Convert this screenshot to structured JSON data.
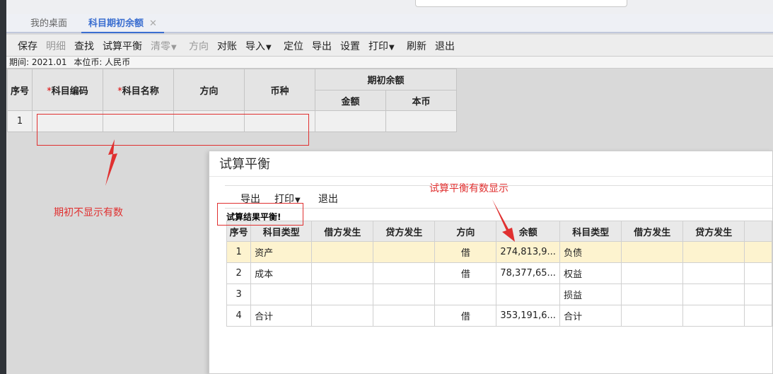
{
  "tabs": {
    "home": "我的桌面",
    "active": "科目期初余额",
    "close": "✕"
  },
  "toolbar": {
    "save": "保存",
    "detail": "明细",
    "find": "查找",
    "trial": "试算平衡",
    "clear": "清零",
    "direction": "方向",
    "reconcile": "对账",
    "import": "导入",
    "locate": "定位",
    "export": "导出",
    "settings": "设置",
    "print": "打印",
    "refresh": "刷新",
    "exit": "退出"
  },
  "period": {
    "label": "期间: 2021.01",
    "currency": "本位币: 人民币"
  },
  "grid": {
    "headers": {
      "seq": "序号",
      "code": "科目编码",
      "name": "科目名称",
      "dir": "方向",
      "cur": "币种",
      "opening": "期初余额",
      "amount": "金额",
      "base": "本币"
    },
    "required_mark": "*",
    "rows": [
      {
        "seq": "1"
      }
    ]
  },
  "annotations": {
    "left": "期初不显示有数",
    "right": "试算平衡有数显示"
  },
  "dialog": {
    "title": "试算平衡",
    "toolbar": {
      "export": "导出",
      "print": "打印",
      "exit": "退出"
    },
    "status": "试算结果平衡!",
    "headers": {
      "seq": "序号",
      "type1": "科目类型",
      "debit1": "借方发生",
      "credit1": "贷方发生",
      "dir": "方向",
      "balance": "余额",
      "type2": "科目类型",
      "debit2": "借方发生",
      "credit2": "贷方发生"
    },
    "rows": [
      {
        "seq": "1",
        "type1": "资产",
        "debit1": "",
        "credit1": "",
        "dir": "借",
        "balance": "274,813,9...",
        "type2": "负债",
        "debit2": "",
        "credit2": ""
      },
      {
        "seq": "2",
        "type1": "成本",
        "debit1": "",
        "credit1": "",
        "dir": "借",
        "balance": "78,377,65...",
        "type2": "权益",
        "debit2": "",
        "credit2": ""
      },
      {
        "seq": "3",
        "type1": "",
        "debit1": "",
        "credit1": "",
        "dir": "",
        "balance": "",
        "type2": "损益",
        "debit2": "",
        "credit2": ""
      },
      {
        "seq": "4",
        "type1": "合计",
        "debit1": "",
        "credit1": "",
        "dir": "借",
        "balance": "353,191,6...",
        "type2": "合计",
        "debit2": "",
        "credit2": ""
      }
    ]
  },
  "colors": {
    "accent": "#3a6ed0",
    "annotation": "#e03030",
    "highlight": "#fdf3cf"
  }
}
